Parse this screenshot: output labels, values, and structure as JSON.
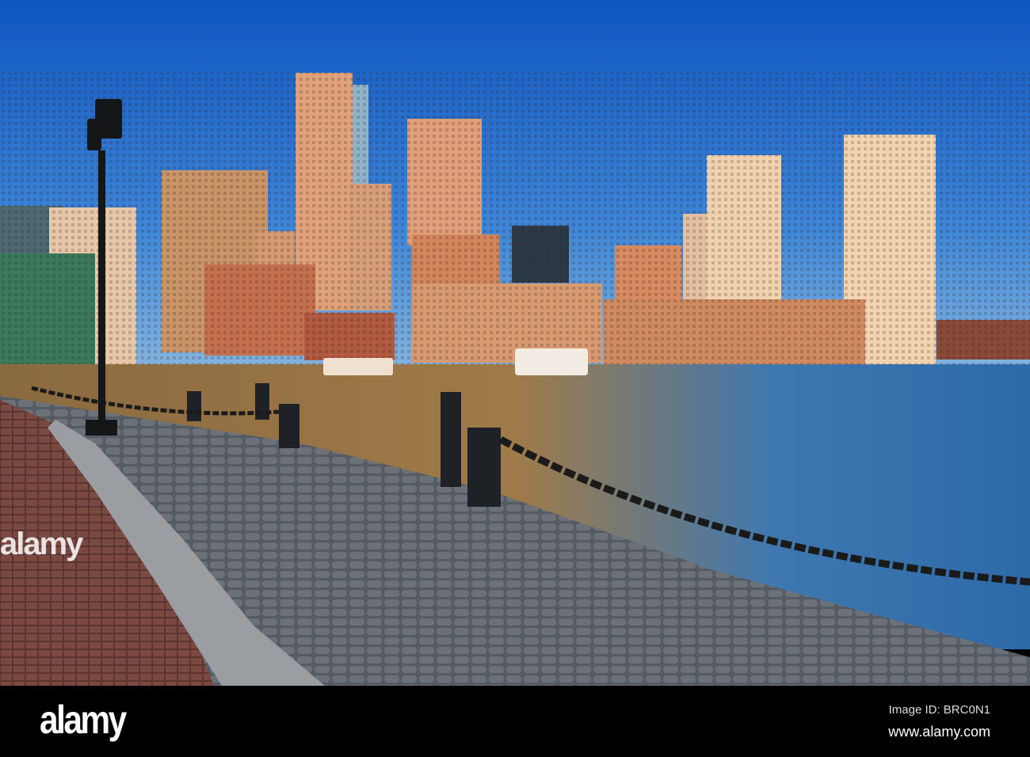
{
  "footer": {
    "logo": "alamy",
    "image_id": "Image ID: BRC0N1",
    "url": "www.alamy.com"
  },
  "watermark": "alamy",
  "colors": {
    "sky_top": "#1560c8",
    "sky_bottom": "#5aa0e0",
    "water": "#4a7fb0",
    "cobble": "#5a6068",
    "brick": "#7a4a40"
  }
}
